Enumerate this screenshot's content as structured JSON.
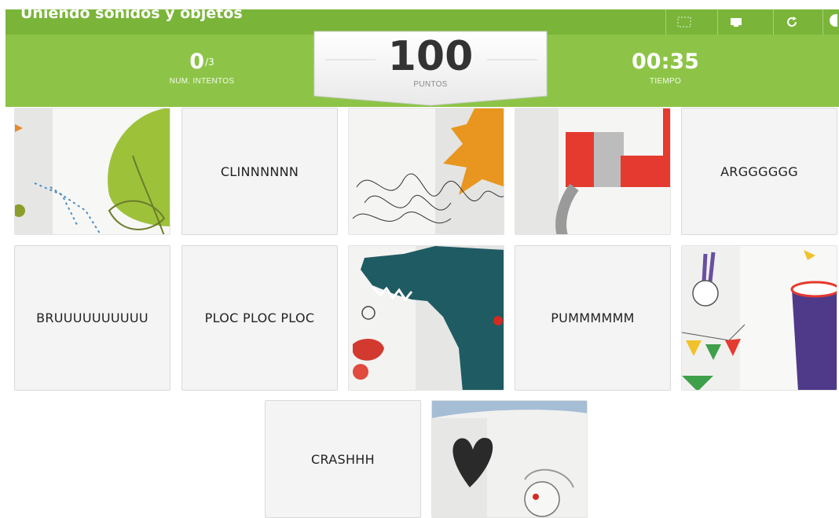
{
  "app": {
    "title": "Uniendo sonidos y objetos"
  },
  "toolbar": {
    "buttons": [
      {
        "icon": "fullscreen-icon"
      },
      {
        "icon": "screen-icon"
      },
      {
        "icon": "restart-icon"
      },
      {
        "icon": "menu-icon"
      }
    ]
  },
  "stats": {
    "attempts_value": "0",
    "attempts_max": "/3",
    "attempts_label": "NUM. INTENTOS",
    "points_value": "100",
    "points_label": "PUNTOS",
    "time_value": "00:35",
    "time_label": "TIEMPO"
  },
  "colors": {
    "bar_dark": "#7ab53a",
    "bar_light": "#8dc447",
    "card_bg": "#f4f4f4"
  },
  "cards": [
    {
      "type": "image",
      "depicts": "watering-can-plant"
    },
    {
      "type": "text",
      "label": "CLINNNNNN"
    },
    {
      "type": "image",
      "depicts": "scribble-sun"
    },
    {
      "type": "image",
      "depicts": "red-hat-cup"
    },
    {
      "type": "text",
      "label": "ARGGGGGG"
    },
    {
      "type": "text",
      "label": "BRUUUUUUUUUU"
    },
    {
      "type": "text",
      "label": "PLOC PLOC PLOC"
    },
    {
      "type": "image",
      "depicts": "wolf-red-riding-hood"
    },
    {
      "type": "text",
      "label": "PUMMMMMM"
    },
    {
      "type": "image",
      "depicts": "rabbit-magic-hat"
    },
    {
      "type": "text",
      "label": "CRASHHH"
    },
    {
      "type": "image",
      "depicts": "heart-girl"
    }
  ]
}
